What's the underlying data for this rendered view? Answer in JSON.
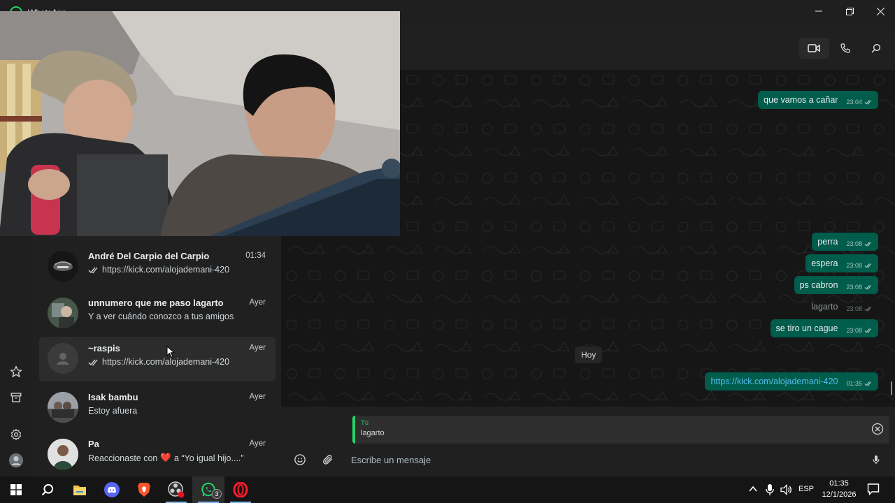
{
  "window": {
    "title": "WhatsApp",
    "controls": [
      "minimize-icon",
      "restore-icon",
      "close-icon"
    ]
  },
  "header": {
    "icons": [
      "video-call-icon",
      "phone-call-icon",
      "search-icon"
    ]
  },
  "rail": {
    "icons": [
      "star-icon",
      "archive-icon",
      "settings-icon",
      "profile-icon"
    ]
  },
  "chats": [
    {
      "name": "André Del Carpio del Carpio",
      "time": "01:34",
      "preview": "https://kick.com/alojademani-420",
      "read_ticks": true,
      "hovered": false
    },
    {
      "name": "unnumero que me paso lagarto",
      "time": "Ayer",
      "preview": "Y a ver cuándo conozco a tus amigos",
      "read_ticks": false,
      "hovered": false
    },
    {
      "name": "~raspis",
      "time": "Ayer",
      "preview": "https://kick.com/alojademani-420",
      "read_ticks": true,
      "hovered": true
    },
    {
      "name": "Isak bambu",
      "time": "Ayer",
      "preview": "Estoy afuera",
      "read_ticks": false,
      "hovered": false
    },
    {
      "name": "Pa",
      "time": "Ayer",
      "preview_before": "Reaccionaste con",
      "preview_emoji": "❤️",
      "preview_after": "a “Yo igual hijo....”",
      "read_ticks": false,
      "hovered": false
    }
  ],
  "messages": [
    {
      "text": "que vamos a cañar",
      "time": "23:04"
    },
    {
      "text": "perra",
      "time": "23:08"
    },
    {
      "text": "espera",
      "time": "23:08"
    },
    {
      "text": "ps cabron",
      "time": "23:08"
    },
    {
      "text": "lagarto",
      "time": "23:08",
      "faded": true
    },
    {
      "text": "se tiro un cague",
      "time": "23:08"
    },
    {
      "text": "https://kick.com/alojademani-420",
      "time": "01:35"
    }
  ],
  "date_separator": "Hoy",
  "reply": {
    "author": "Tú",
    "text": "lagarto"
  },
  "composer": {
    "placeholder": "Escribe un mensaje"
  },
  "taskbar": {
    "apps": [
      "windows-start-icon",
      "search-icon",
      "file-explorer-icon",
      "discord-icon",
      "brave-icon",
      "obs-icon",
      "whatsapp-icon",
      "opera-icon"
    ],
    "whatsapp_badge": "3",
    "language": "ESP",
    "clock_time": "01:35",
    "clock_date": "12/1/2026"
  },
  "colors": {
    "accent": "#25d366",
    "bubble": "#005c4b",
    "panel": "#202020"
  }
}
